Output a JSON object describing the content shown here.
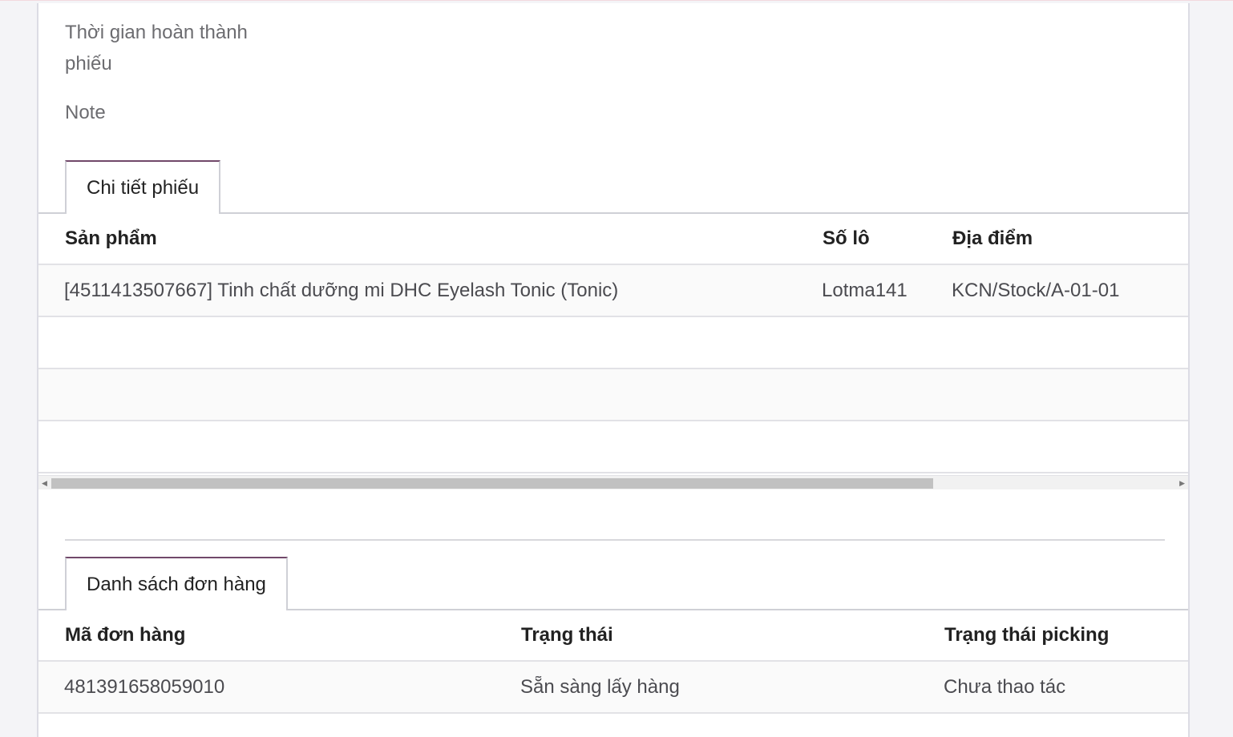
{
  "form": {
    "completion_time_label": "Thời gian hoàn thành phiếu",
    "completion_time_line1": "Thời gian hoàn thành",
    "completion_time_line2": "phiếu",
    "note_label": "Note"
  },
  "detail_tab": {
    "label": "Chi tiết phiếu",
    "columns": [
      "Sản phẩm",
      "Số lô",
      "Địa điểm"
    ],
    "rows": [
      [
        "[4511413507667] Tinh chất dưỡng mi DHC Eyelash Tonic (Tonic)",
        "Lotma141",
        "KCN/Stock/A-01-01"
      ]
    ]
  },
  "orders_tab": {
    "label": "Danh sách đơn hàng",
    "columns": [
      "Mã đơn hàng",
      "Trạng thái",
      "Trạng thái picking"
    ],
    "rows": [
      [
        "481391658059010",
        "Sẵn sàng lấy hàng",
        "Chưa thao tác"
      ]
    ]
  }
}
